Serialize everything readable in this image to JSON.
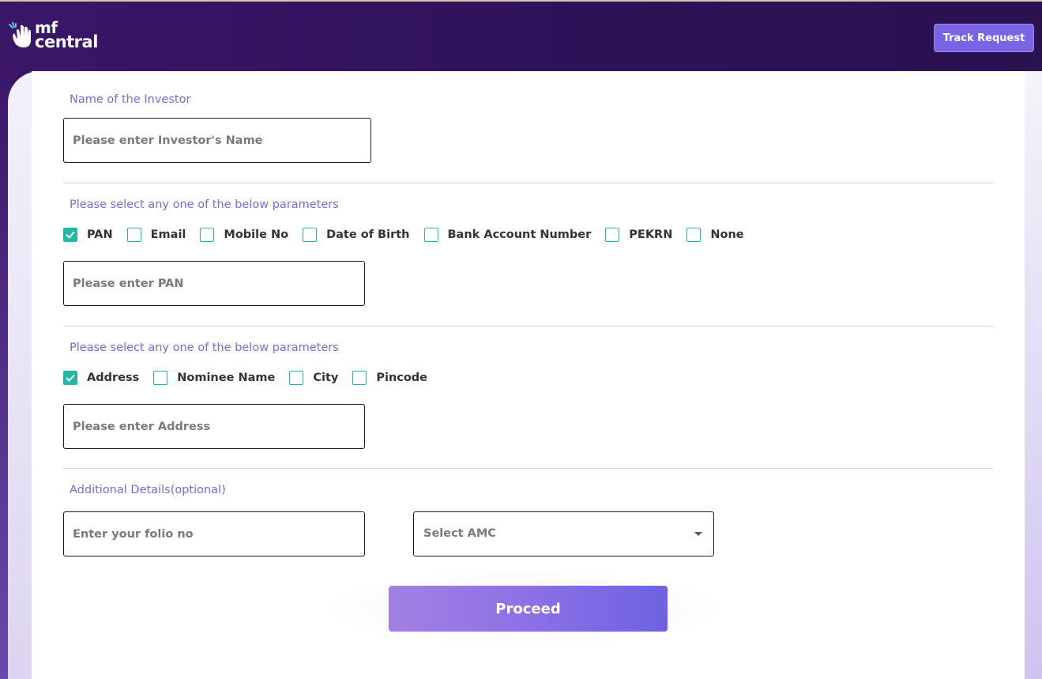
{
  "header": {
    "logo": {
      "line1": "mf",
      "line2": "central"
    },
    "track_request_label": "Track Request"
  },
  "investor_name": {
    "label": "Name of the Investor",
    "placeholder": "Please enter Investor's Name"
  },
  "identity": {
    "label": "Please select any one of the below parameters",
    "options": [
      {
        "label": "PAN",
        "checked": true
      },
      {
        "label": "Email",
        "checked": false
      },
      {
        "label": "Mobile No",
        "checked": false
      },
      {
        "label": "Date of Birth",
        "checked": false
      },
      {
        "label": "Bank Account Number",
        "checked": false
      },
      {
        "label": "PEKRN",
        "checked": false
      },
      {
        "label": "None",
        "checked": false
      }
    ],
    "placeholder": "Please enter PAN"
  },
  "location": {
    "label": "Please select any one of the below parameters",
    "options": [
      {
        "label": "Address",
        "checked": true
      },
      {
        "label": "Nominee Name",
        "checked": false
      },
      {
        "label": "City",
        "checked": false
      },
      {
        "label": "Pincode",
        "checked": false
      }
    ],
    "placeholder": "Please enter Address"
  },
  "additional": {
    "label": "Additional Details(optional)",
    "folio_placeholder": "Enter your folio no",
    "amc_select": "Select AMC"
  },
  "proceed_label": "Proceed",
  "colors": {
    "header_bg": "#2d1257",
    "accent": "#7b63e6",
    "checkbox": "#22b8a6",
    "label": "#7d68d8"
  }
}
